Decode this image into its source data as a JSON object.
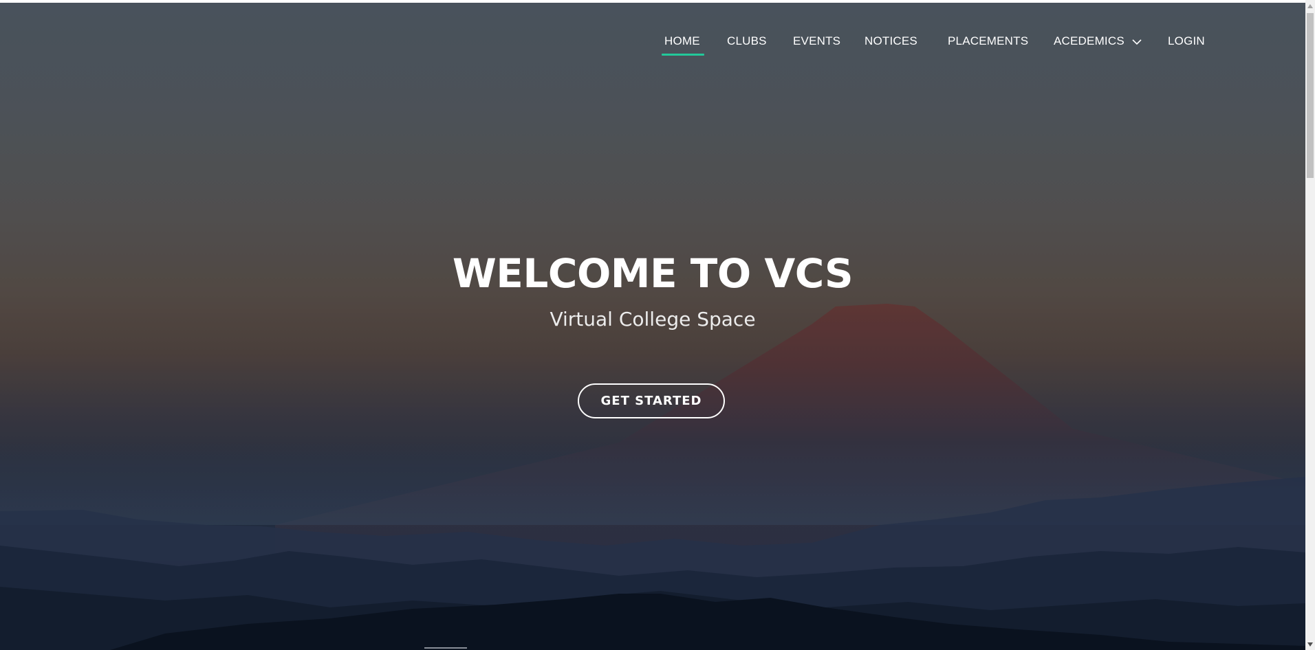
{
  "nav": {
    "items": [
      {
        "label": "HOME",
        "active": true
      },
      {
        "label": "CLUBS",
        "active": false
      },
      {
        "label": "EVENTS",
        "active": false
      },
      {
        "label": "NOTICES",
        "active": false
      },
      {
        "label": "PLACEMENTS",
        "active": false
      },
      {
        "label": "ACEDEMICS",
        "active": false,
        "dropdown": true
      },
      {
        "label": "LOGIN",
        "active": false
      }
    ]
  },
  "hero": {
    "title": "WELCOME TO VCS",
    "subtitle": "Virtual College Space",
    "cta_label": "GET STARTED",
    "background": "mountain-sunset-image"
  },
  "colors": {
    "accent": "#22c99a",
    "text": "#ffffff"
  },
  "icons": {
    "dropdown": "chevron-down-icon",
    "scroll_up": "scroll-up-arrow-icon",
    "scroll_down": "scroll-down-arrow-icon"
  }
}
